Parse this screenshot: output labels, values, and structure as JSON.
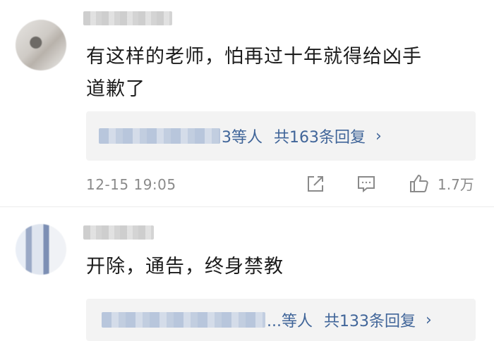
{
  "comments": [
    {
      "text_line1": "有这样的老师，怕再过十年就得给凶手",
      "text_line2": "道歉了",
      "reply_suffix": "3等人",
      "reply_count": "共163条回复",
      "chevron": "›",
      "time": "12-15 19:05",
      "likes": "1.7万"
    },
    {
      "text_line1": "开除，通告，终身禁教",
      "reply_suffix": "...等人",
      "reply_count": "共133条回复",
      "chevron": "›"
    }
  ],
  "icons": [
    "share-icon",
    "comment-icon",
    "like-icon"
  ],
  "colors": {
    "link": "#406599",
    "meta": "#8a8a8a",
    "reply_bg": "#f3f3f3"
  }
}
